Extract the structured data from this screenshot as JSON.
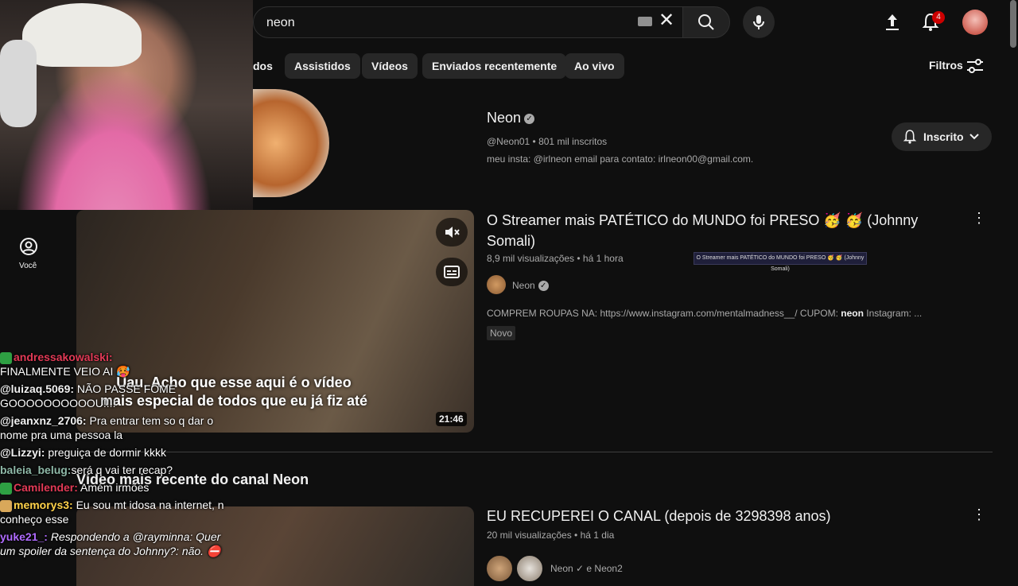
{
  "header": {
    "search_query": "neon",
    "notification_count": "4"
  },
  "chips": [
    "dos",
    "Assistidos",
    "Vídeos",
    "Enviados recentemente",
    "Ao vivo"
  ],
  "filters_label": "Filtros",
  "channel": {
    "name": "Neon",
    "meta": "@Neon01 • 801 mil inscritos",
    "description": "meu insta: @irlneon email para contato: irlneon00@gmail.com.",
    "subscribe_label": "Inscrito"
  },
  "sidebar": {
    "you_label": "Você"
  },
  "video1": {
    "title": "O Streamer mais PATÉTICO do MUNDO foi PRESO 🥳 🥳 (Johnny Somali)",
    "meta": "8,9 mil visualizações • há 1 hora",
    "tooltip": "O Streamer mais PATÉTICO do MUNDO foi PRESO 🥳 🥳 (Johnny Somali)",
    "channel": "Neon",
    "description_prefix": "COMPREM ROUPAS NA: https://www.instagram.com/mentalmadness__/ CUPOM: ",
    "description_bold": "neon",
    "description_suffix": " Instagram: ...",
    "badge": "Novo",
    "duration": "21:46",
    "caption": "Uau. Acho que esse aqui é o vídeo mais especial de todos que eu já fiz até"
  },
  "section_title": "Vídeo mais recente do canal Neon",
  "video2": {
    "title": "EU RECUPEREI O CANAL (depois de 3298398 anos)",
    "meta": "20 mil visualizações • há 1 dia",
    "channels": "Neon ✓ e Neon2"
  },
  "chat": [
    {
      "user": "andressakowalski:",
      "text": "FINALMENTE VEIO AI 🥵",
      "color": "#e23a56"
    },
    {
      "user": "@luizaq.5069:",
      "text": "NÃO PASSE FOME GOOOOOOOOOOU!!!!",
      "color": "#ffffff"
    },
    {
      "user": "@jeanxnz_2706:",
      "text": "Pra entrar tem so q dar o nome pra uma pessoa la",
      "color": "#ffffff"
    },
    {
      "user": "@Lizzyi:",
      "text": "preguiça de dormir kkkk",
      "color": "#ffffff"
    },
    {
      "user": "baleia_belug:",
      "text": "será q vai ter recap?",
      "color": "#8fb9a8"
    },
    {
      "user": "Camilender:",
      "text": "Amém irmões",
      "color": "#e23a56"
    },
    {
      "user": "memorys3:",
      "text": "Eu sou mt idosa na internet, n conheço esse",
      "color": "#ffd24a"
    },
    {
      "user": "yuke21_:",
      "text": "Respondendo a @rayminna: Quer um spoiler da sentença do Johnny?: não. ⛔",
      "color": "#b06bff"
    }
  ],
  "colors": {
    "background": "#0f0f0f",
    "chip": "#272727",
    "secondary_text": "#aaaaaa",
    "badge_red": "#cc0000"
  },
  "icons": [
    "keyboard-icon",
    "close-icon",
    "search-icon",
    "mic-icon",
    "upload-icon",
    "bell-icon",
    "filter-icon",
    "verified-icon",
    "bell-subscribe-icon",
    "chevron-down-icon",
    "person-circle-icon",
    "mute-icon",
    "captions-icon",
    "more-vert-icon"
  ]
}
